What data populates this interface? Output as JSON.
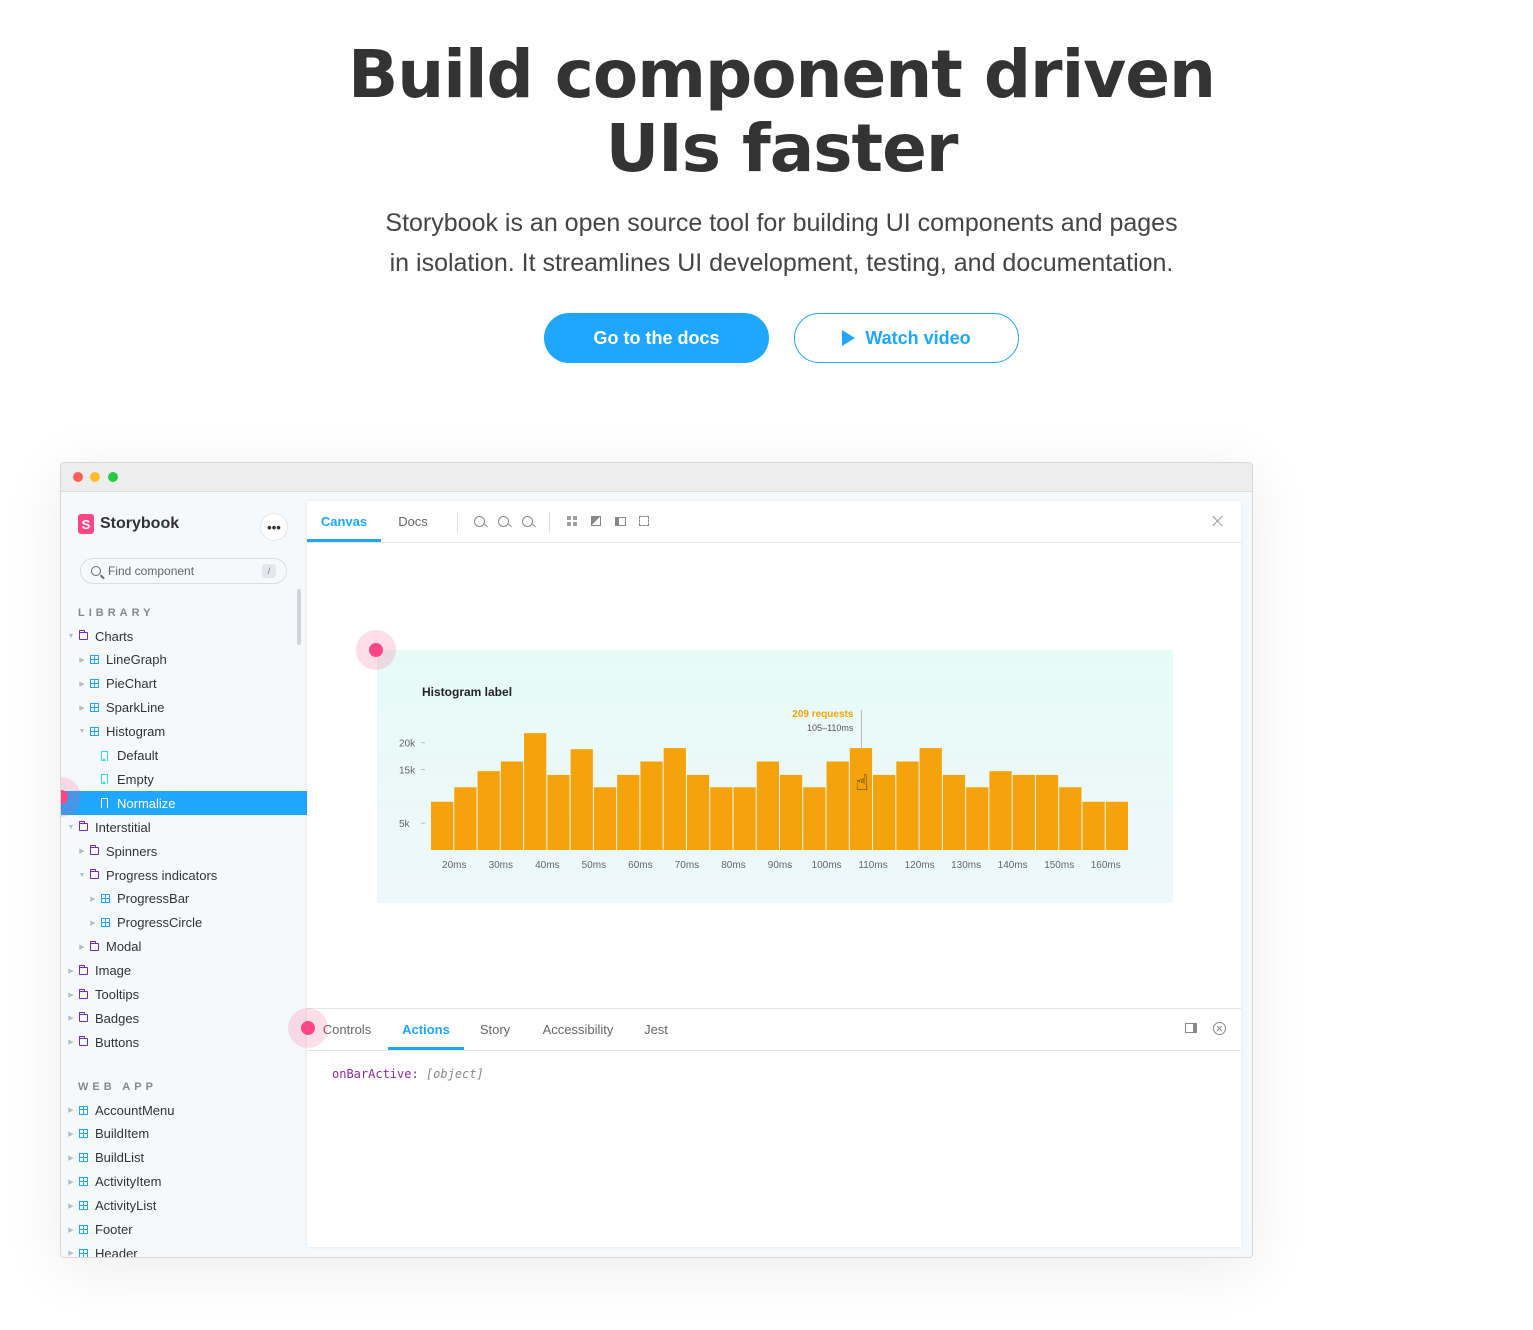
{
  "hero": {
    "title_line1": "Build component driven",
    "title_line2": "UIs faster",
    "subtitle_line1": "Storybook is an open source tool for building UI components and pages",
    "subtitle_line2": "in isolation. It streamlines UI development, testing, and documentation.",
    "primary_cta": "Go to the docs",
    "secondary_cta": "Watch video"
  },
  "colors": {
    "accent": "#1ea7fd",
    "brand_pink": "#ff4785",
    "bar": "#f5a30a",
    "highlight_text": "#f5a30a"
  },
  "sidebar": {
    "brand": "Storybook",
    "logo_letter": "S",
    "more_icon": "ellipsis-icon",
    "search_placeholder": "Find component",
    "search_shortcut": "/",
    "sections": [
      {
        "heading": "LIBRARY",
        "items": [
          {
            "label": "Charts",
            "icon": "folder-icon",
            "depth": 0,
            "expanded": true
          },
          {
            "label": "LineGraph",
            "icon": "component-icon",
            "depth": 1
          },
          {
            "label": "PieChart",
            "icon": "component-icon",
            "depth": 1
          },
          {
            "label": "SparkLine",
            "icon": "component-icon",
            "depth": 1
          },
          {
            "label": "Histogram",
            "icon": "component-icon",
            "depth": 1,
            "expanded": true
          },
          {
            "label": "Default",
            "icon": "bookmark-icon",
            "depth": 2
          },
          {
            "label": "Empty",
            "icon": "bookmark-icon",
            "depth": 2
          },
          {
            "label": "Normalize",
            "icon": "bookmark-icon",
            "depth": 2,
            "selected": true
          },
          {
            "label": "Interstitial",
            "icon": "folder-icon",
            "depth": 0,
            "expanded": true
          },
          {
            "label": "Spinners",
            "icon": "folder-icon",
            "depth": 1
          },
          {
            "label": "Progress indicators",
            "icon": "folder-icon",
            "depth": 1,
            "expanded": true
          },
          {
            "label": "ProgressBar",
            "icon": "component-icon",
            "depth": 2
          },
          {
            "label": "ProgressCircle",
            "icon": "component-icon",
            "depth": 2
          },
          {
            "label": "Modal",
            "icon": "folder-icon",
            "depth": 1
          },
          {
            "label": "Image",
            "icon": "folder-icon",
            "depth": 0
          },
          {
            "label": "Tooltips",
            "icon": "folder-icon",
            "depth": 0
          },
          {
            "label": "Badges",
            "icon": "folder-icon",
            "depth": 0
          },
          {
            "label": "Buttons",
            "icon": "folder-icon",
            "depth": 0
          }
        ]
      },
      {
        "heading": "WEB APP",
        "items": [
          {
            "label": "AccountMenu",
            "icon": "component-icon",
            "depth": 0
          },
          {
            "label": "BuildItem",
            "icon": "component-icon",
            "depth": 0
          },
          {
            "label": "BuildList",
            "icon": "component-icon",
            "depth": 0
          },
          {
            "label": "ActivityItem",
            "icon": "component-icon",
            "depth": 0
          },
          {
            "label": "ActivityList",
            "icon": "component-icon",
            "depth": 0
          },
          {
            "label": "Footer",
            "icon": "component-icon",
            "depth": 0
          },
          {
            "label": "Header",
            "icon": "component-icon",
            "depth": 0
          }
        ]
      }
    ]
  },
  "toolbar": {
    "tabs": [
      "Canvas",
      "Docs"
    ],
    "active_tab": "Canvas",
    "icons": [
      "zoom-in-icon",
      "zoom-out-icon",
      "zoom-reset-icon",
      "grid-icon",
      "background-icon",
      "viewport-icon",
      "outline-icon",
      "fullscreen-icon"
    ]
  },
  "panel": {
    "tabs": [
      "Controls",
      "Actions",
      "Story",
      "Accessibility",
      "Jest"
    ],
    "active_tab": "Actions",
    "log_key": "onBarActive:",
    "log_value": "[object]",
    "icons": [
      "dock-icon",
      "close-icon"
    ]
  },
  "chart_data": {
    "type": "bar",
    "title": "Histogram label",
    "ylabel": "",
    "xlabel": "",
    "y_ticks": [
      5000,
      15000,
      20000
    ],
    "y_tick_labels": [
      "5k",
      "15k",
      "20k"
    ],
    "ylim": [
      0,
      22000
    ],
    "x_tick_labels": [
      "20ms",
      "30ms",
      "40ms",
      "50ms",
      "60ms",
      "70ms",
      "80ms",
      "90ms",
      "100ms",
      "110ms",
      "120ms",
      "130ms",
      "140ms",
      "150ms",
      "160ms"
    ],
    "values": [
      9000,
      11700,
      14700,
      16500,
      21800,
      14000,
      18800,
      11700,
      14000,
      16500,
      19000,
      14000,
      11700,
      11700,
      16500,
      14000,
      11700,
      16500,
      19000,
      14000,
      16500,
      19000,
      14000,
      11700,
      14700,
      14000,
      14000,
      11700,
      9000,
      9000
    ],
    "highlighted_index": 18,
    "tooltip_title": "209 requests",
    "tooltip_sub": "105–110ms",
    "grid": false,
    "legend": "none"
  }
}
